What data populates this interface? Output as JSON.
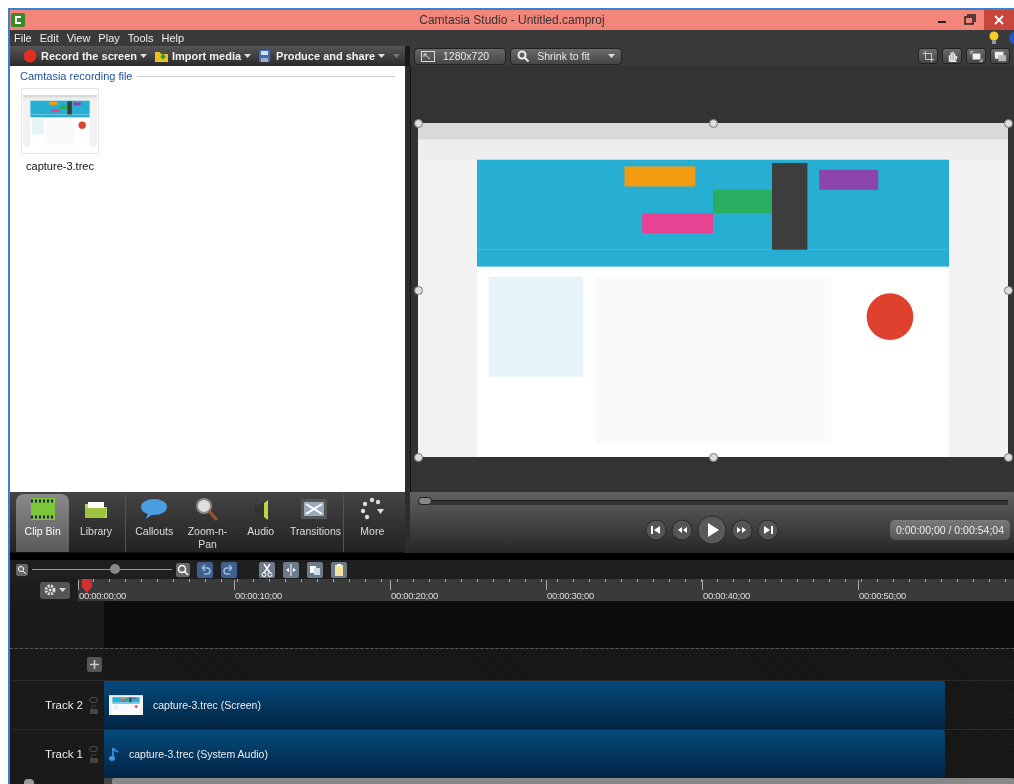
{
  "window": {
    "title": "Camtasia Studio - Untitled.camproj"
  },
  "menu": [
    "File",
    "Edit",
    "View",
    "Play",
    "Tools",
    "Help"
  ],
  "toolbar": [
    {
      "label": "Record the screen",
      "kind": "record"
    },
    {
      "label": "Import media",
      "kind": "import"
    },
    {
      "label": "Produce and share",
      "kind": "produce"
    }
  ],
  "clip_bin": {
    "section": "Camtasia recording file",
    "clips": [
      {
        "name": "capture-3.trec",
        "kind": "picture"
      }
    ]
  },
  "preview_toolbar": {
    "dimensions": "1280x720",
    "zoom": "Shrink to fit"
  },
  "tabs": [
    {
      "label": "Clip Bin",
      "kind": "clipbin",
      "selected": true
    },
    {
      "label": "Library",
      "kind": "library",
      "selected": false
    },
    {
      "label": "Callouts",
      "kind": "callouts",
      "selected": false
    },
    {
      "label": "Zoom-n-Pan",
      "kind": "zoom",
      "selected": false
    },
    {
      "label": "Audio",
      "kind": "audio",
      "selected": false
    },
    {
      "label": "Transitions",
      "kind": "transitions",
      "selected": false
    },
    {
      "label": "More",
      "kind": "more",
      "selected": false
    }
  ],
  "player": {
    "level": 0,
    "time": "0:00:00;00 / 0:00:54;04"
  },
  "timeline": {
    "zoom": {
      "level": 0.6
    },
    "ruler": [
      "00:00:00;00",
      "00:00:10;00",
      "00:00:20;00",
      "00:00:30;00",
      "00:00:40;00",
      "00:00:50;00"
    ],
    "tracks": [
      {
        "name": "Track 2",
        "clip": "capture-3.trec (Screen)",
        "kind": "video"
      },
      {
        "name": "Track 1",
        "clip": "capture-3.trec (System Audio)",
        "kind": "audio"
      }
    ]
  }
}
